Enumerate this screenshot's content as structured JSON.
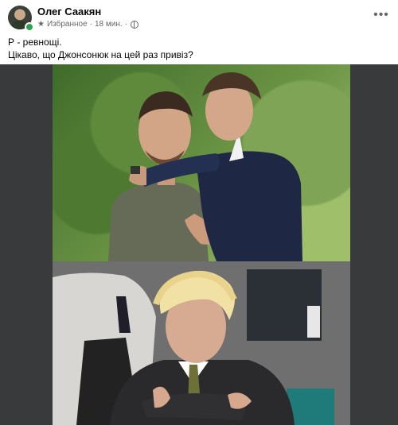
{
  "post": {
    "author": "Олег Саакян",
    "audience": "Избранное",
    "separator": "·",
    "time": "18 мин.",
    "more_icon": "more-horizontal-icon",
    "text_lines": [
      "Р - ревнощі.",
      "Цікаво, що Джонсонюк на цей раз привіз?"
    ]
  },
  "colors": {
    "online": "#31a24c",
    "meta_text": "#65676b",
    "image_background": "#393a3c"
  }
}
